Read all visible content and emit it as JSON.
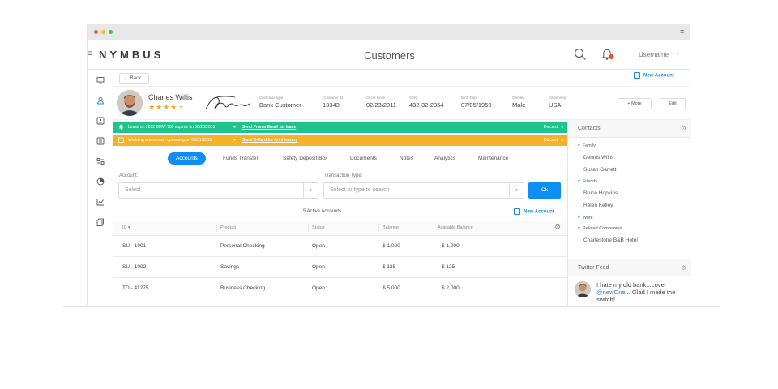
{
  "window": {
    "dots": [
      "#f25a3a",
      "#f5b82e",
      "#3dc24b"
    ]
  },
  "header": {
    "logo": "NYMBUS",
    "title": "Customers",
    "username": "Username",
    "caret": "▾",
    "menu_icon": "≡"
  },
  "toolbar": {
    "back_label": "Back",
    "new_account_label": "New Account"
  },
  "customer": {
    "name": "Charles Willis",
    "stars": "★★★★★",
    "rating": 4.5,
    "fields": [
      {
        "label": "Customer type",
        "value": "Bank Customer"
      },
      {
        "label": "Customer ID",
        "value": "13343"
      },
      {
        "label": "Client since",
        "value": "02/23/2011"
      },
      {
        "label": "SSN",
        "value": "432-32-2354"
      },
      {
        "label": "Birth Date",
        "value": "07/05/1950"
      },
      {
        "label": "Gender",
        "value": "Male"
      },
      {
        "label": "Citizenship",
        "value": "USA"
      }
    ],
    "more_label": "+ More",
    "edit_label": "Edit"
  },
  "alerts": [
    {
      "icon": "bell-icon",
      "message": "Lease on 2012 BMW 750 expires on 06/20/2015",
      "arrow": "➜",
      "link": "Send Promo Email for lease",
      "discard": "Discard",
      "close": "✕",
      "color": "#1fc48a"
    },
    {
      "icon": "calendar-icon",
      "message": "Wedding anniversary upcoming on 05/31/2015",
      "arrow": "➜",
      "link": "Send E-Card for Anniversary",
      "discard": "Discard",
      "close": "✕",
      "color": "#f5b229"
    }
  ],
  "tabs": [
    "Accounts",
    "Funds Transfer",
    "Safety Deposit Box",
    "Documents",
    "Notes",
    "Analytics",
    "Maintenance"
  ],
  "form": {
    "account_label": "Account:",
    "account_value": "Select",
    "transaction_label": "Transaction Type:",
    "transaction_placeholder": "Select or type to search",
    "ok_label": "Ok",
    "caret": "▾"
  },
  "accounts": {
    "count_text": "5 Active Accounts",
    "new_account_label": "New Account",
    "columns": [
      "ID",
      "Product",
      "Status",
      "Balance",
      "Available Balance"
    ],
    "sort_caret": "▾",
    "rows": [
      [
        "SU - 1001",
        "Personal Checking",
        "Open",
        "$ 1,000",
        "$ 1,000"
      ],
      [
        "SU - 1002",
        "Savings",
        "Open",
        "$ 125",
        "$ 125"
      ],
      [
        "TD - 41275",
        "Business Checking",
        "Open",
        "$ 5,000",
        "$ 2,000"
      ]
    ]
  },
  "contacts": {
    "title": "Contacts",
    "gear": "⚙",
    "triangle": "▾",
    "groups": [
      {
        "name": "Family",
        "people": [
          "Dennis Willis",
          "Susan Garrett"
        ]
      },
      {
        "name": "Friends",
        "people": [
          "Bruce Hopkins",
          "Helen Kelley"
        ]
      },
      {
        "name": "Work",
        "people": []
      },
      {
        "name": "Related Companies",
        "people": [
          "Charlestone B&B Hotel"
        ]
      }
    ]
  },
  "twitter": {
    "title": "Twitter Feed",
    "gear": "⚙",
    "tweet_before": "I hate my old bank...Love ",
    "tweet_mention": "@newOne",
    "tweet_after": "... Glad I made the switch!"
  }
}
